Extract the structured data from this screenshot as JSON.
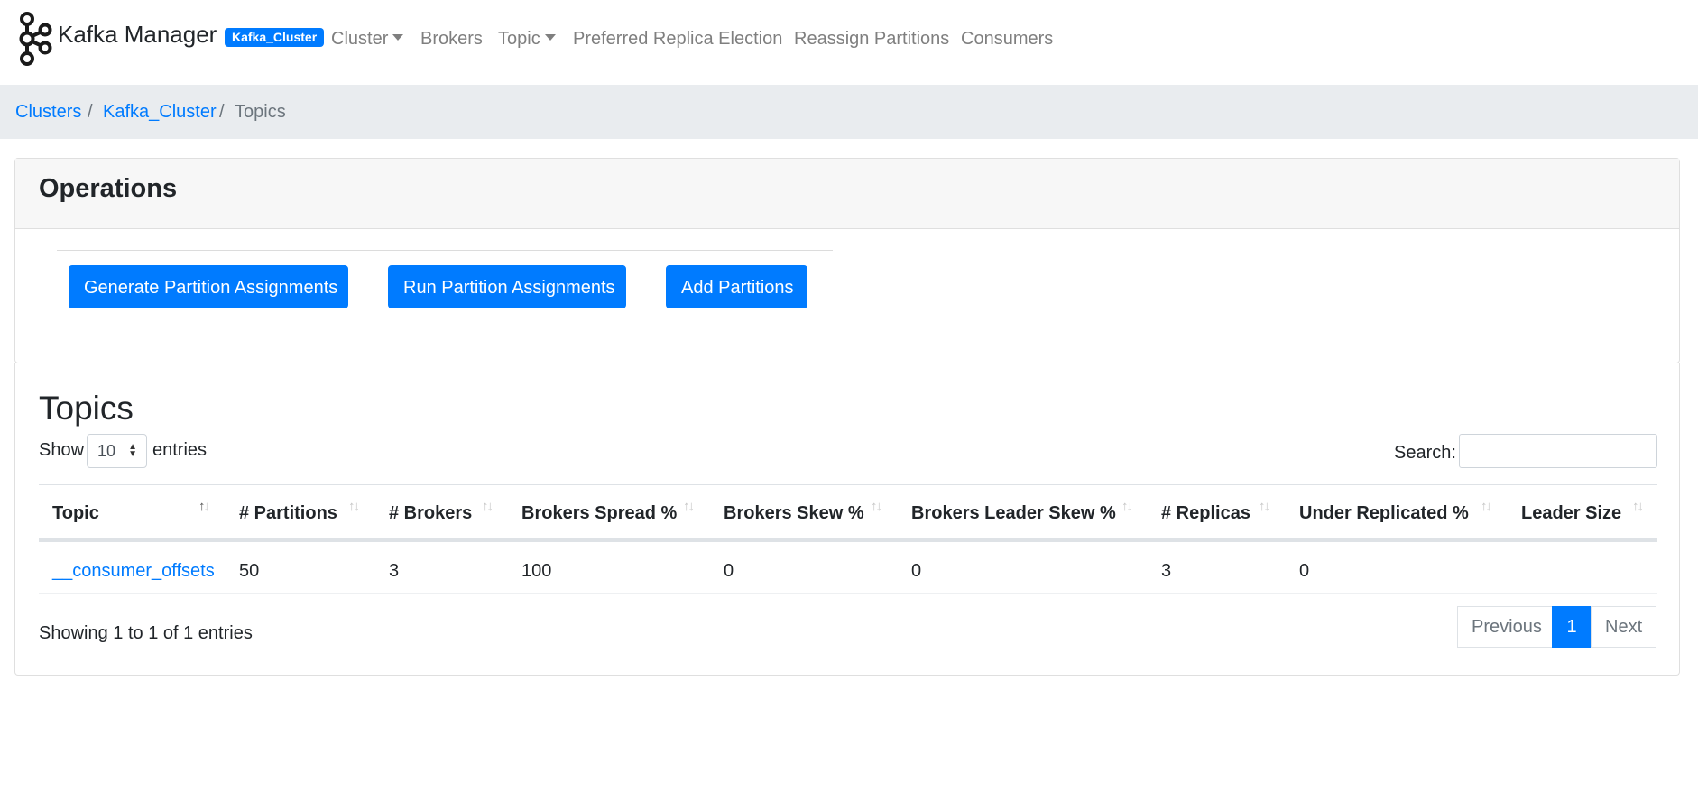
{
  "navbar": {
    "brand": "Kafka Manager",
    "cluster_badge": "Kafka_Cluster",
    "items": [
      {
        "label": "Cluster"
      },
      {
        "label": "Brokers"
      },
      {
        "label": "Topic"
      },
      {
        "label": "Preferred Replica Election"
      },
      {
        "label": "Reassign Partitions"
      },
      {
        "label": "Consumers"
      }
    ],
    "dropdown_items": [
      "Cluster",
      "Topic"
    ]
  },
  "breadcrumb": {
    "items": [
      {
        "label": "Clusters"
      },
      {
        "label": "Kafka_Cluster"
      },
      {
        "label": "Topics"
      }
    ],
    "separator": "/"
  },
  "operations": {
    "title": "Operations",
    "buttons": [
      {
        "label": "Generate Partition Assignments"
      },
      {
        "label": "Run Partition Assignments"
      },
      {
        "label": "Add Partitions"
      }
    ]
  },
  "topics": {
    "title": "Topics",
    "show_label": "Show",
    "page_size": "10",
    "entries_label": "entries",
    "search_label": "Search:",
    "search_value": "",
    "columns": [
      "Topic",
      "# Partitions",
      "# Brokers",
      "Brokers Spread %",
      "Brokers Skew %",
      "Brokers Leader Skew %",
      "# Replicas",
      "Under Replicated %",
      "Leader Size"
    ],
    "sorted_column": "Topic",
    "sort_direction": "ascending",
    "rows": [
      [
        "__consumer_offsets",
        "50",
        "3",
        "100",
        "0",
        "0",
        "3",
        "0",
        ""
      ]
    ],
    "info": "Showing 1 to 1 of 1 entries",
    "pagination": {
      "previous": "Previous",
      "current": "1",
      "next": "Next"
    }
  },
  "colors": {
    "primary": "#007bff",
    "nav_text": "#7f7f7f",
    "breadcrumb_bg": "#e9ecef"
  }
}
